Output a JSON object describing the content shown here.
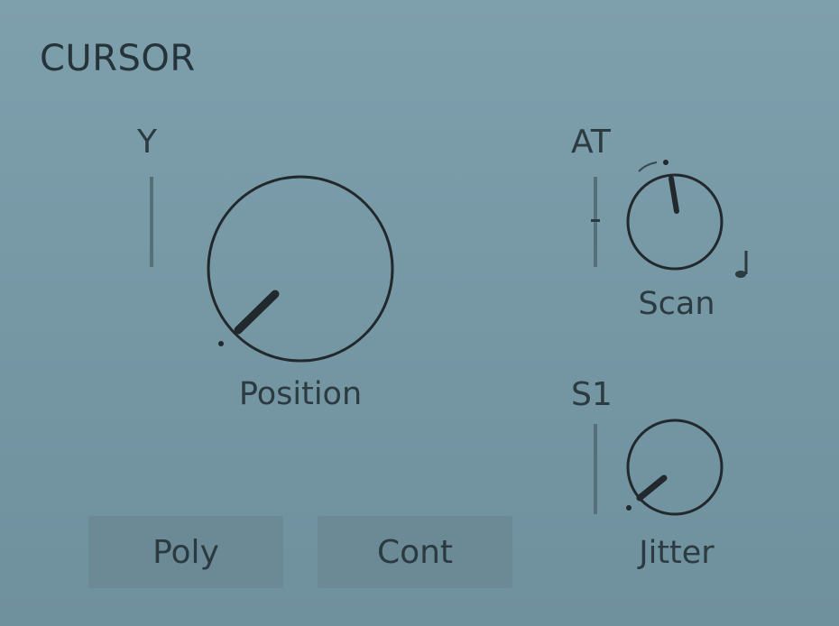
{
  "panel": {
    "title": "CURSOR"
  },
  "modulators": {
    "position_source": "Y",
    "scan_source": "AT",
    "jitter_source": "S1"
  },
  "knobs": {
    "position": {
      "label": "Position",
      "value": 0.12
    },
    "scan": {
      "label": "Scan",
      "value": 0.48
    },
    "jitter": {
      "label": "Jitter",
      "value": 0.1
    }
  },
  "buttons": {
    "poly": "Poly",
    "cont": "Cont"
  },
  "icons": {
    "scan_note": "note-icon"
  }
}
